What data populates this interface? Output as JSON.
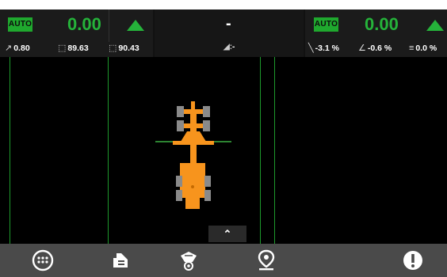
{
  "left_panel": {
    "mode": "AUTO",
    "value": "0.00",
    "readouts": [
      {
        "icon": "slope-icon",
        "value": "0.80"
      },
      {
        "icon": "left-blade-icon",
        "value": "89.63"
      },
      {
        "icon": "right-blade-icon",
        "value": "90.43"
      }
    ]
  },
  "mid_panel": {
    "value": "-",
    "readout": "-"
  },
  "right_panel": {
    "mode": "AUTO",
    "value": "0.00",
    "readouts": [
      {
        "icon": "cross-slope-icon",
        "value": "-3.1 %"
      },
      {
        "icon": "mainfall-icon",
        "value": "-0.6 %"
      },
      {
        "icon": "blade-slope-icon",
        "value": "0.0 %"
      }
    ]
  },
  "colors": {
    "accent_green": "#25b33a",
    "machine_orange": "#f7941d",
    "guide_line": "#1e9a2c"
  },
  "bottom_bar": {
    "buttons": [
      "menu-icon",
      "machine-setup-icon",
      "sensor-view-icon",
      "location-pin-icon",
      "warning-icon"
    ]
  }
}
